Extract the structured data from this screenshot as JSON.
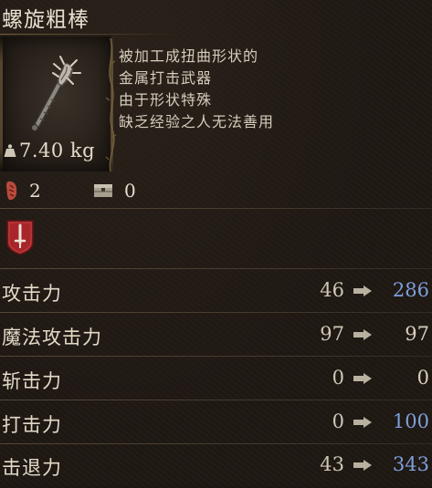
{
  "item": {
    "name": "螺旋粗棒",
    "weight": "7.40 kg",
    "description": [
      "被加工成扭曲形状的",
      "金属打击武器",
      "由于形状特殊",
      "缺乏经验之人无法善用"
    ],
    "upgrade_count": "2",
    "storage_count": "0",
    "icons": {
      "weapon": "spiked-club-icon",
      "weight": "weight-icon",
      "upgrade": "smithing-stone-icon",
      "storage": "chest-icon",
      "affinity": "sword-crest-icon",
      "arrow": "arrow-right-icon"
    }
  },
  "stats": [
    {
      "label": "攻击力",
      "old": "46",
      "new": "286",
      "new_color": "#7f9fdc"
    },
    {
      "label": "魔法攻击力",
      "old": "97",
      "new": "97",
      "new_color": "#d8cfbe"
    },
    {
      "label": "斩击力",
      "old": "0",
      "new": "0",
      "new_color": "#d8cfbe"
    },
    {
      "label": "打击力",
      "old": "0",
      "new": "100",
      "new_color": "#7f9fdc"
    },
    {
      "label": "击退力",
      "old": "43",
      "new": "343",
      "new_color": "#7f9fdc"
    }
  ],
  "colors": {
    "increase": "#7f9fdc",
    "neutral": "#d8cfbe",
    "badge": "#a8262a"
  }
}
